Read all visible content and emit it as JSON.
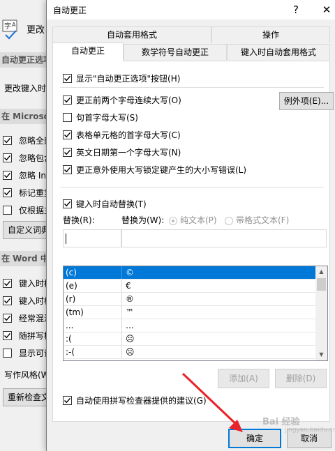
{
  "background_window": {
    "title": "更改",
    "section_autocorrect": "自动更正选项",
    "change_text": "更改键入时",
    "section_microsoft": "在 Microsoft",
    "ms_items": [
      "忽略全部",
      "忽略包含",
      "忽略 In",
      "标记重复",
      "仅根据主"
    ],
    "ms_checked": [
      true,
      true,
      true,
      true,
      false
    ],
    "custom_dict_button": "自定义词典",
    "section_word": "在 Word 中",
    "word_items": [
      "键入时检",
      "键入时标",
      "经常混淆",
      "随拼写检",
      "显示可读"
    ],
    "word_checked": [
      true,
      true,
      true,
      true,
      false
    ],
    "writing_style_label": "写作风格(W",
    "recheck_button": "重新检查文"
  },
  "dialog": {
    "title": "自动更正",
    "help": "?",
    "close": "✕",
    "tabs_row1": [
      "自动套用格式",
      "操作"
    ],
    "tabs_row2": [
      "自动更正",
      "数学符号自动更正",
      "键入时自动套用格式"
    ],
    "options": {
      "show_button": "显示\"自动更正选项\"按钮(H)",
      "two_initial_caps": "更正前两个字母连续大写(O)",
      "first_letter_sentence": "句首字母大写(S)",
      "first_letter_table_cell": "表格单元格的首字母大写(C)",
      "day_names": "英文日期第一个字母大写(N)",
      "caps_lock": "更正意外使用大写锁定键产生的大小写错误(L)"
    },
    "options_checked": {
      "show_button": true,
      "two_initial_caps": true,
      "first_letter_sentence": false,
      "first_letter_table_cell": true,
      "day_names": true,
      "caps_lock": true
    },
    "exceptions_button": "例外项(E)...",
    "replace_as_you_type": "键入时自动替换(T)",
    "replace_label": "替换(R):",
    "with_label": "替换为(W):",
    "plain_text": "纯文本(P)",
    "formatted_text": "带格式文本(F)",
    "replace_value": "",
    "with_value": "",
    "entries": [
      {
        "from": "(c)",
        "to": "©"
      },
      {
        "from": "(e)",
        "to": "€"
      },
      {
        "from": "(r)",
        "to": "®"
      },
      {
        "from": "(tm)",
        "to": "™"
      },
      {
        "from": "...",
        "to": "…"
      },
      {
        "from": ":(",
        "to": "☹"
      },
      {
        "from": ":-(",
        "to": "☹"
      }
    ],
    "add_button": "添加(A)",
    "delete_button": "删除(D)",
    "spell_suggestions": "自动使用拼写检查器提供的建议(G)",
    "ok_button": "确定",
    "cancel_button": "取消"
  },
  "watermark": {
    "main": "Bai 经验",
    "sub": "jingyan.baidu.com"
  },
  "colors": {
    "selection": "#0078d7",
    "arrow": "#e8232a"
  }
}
